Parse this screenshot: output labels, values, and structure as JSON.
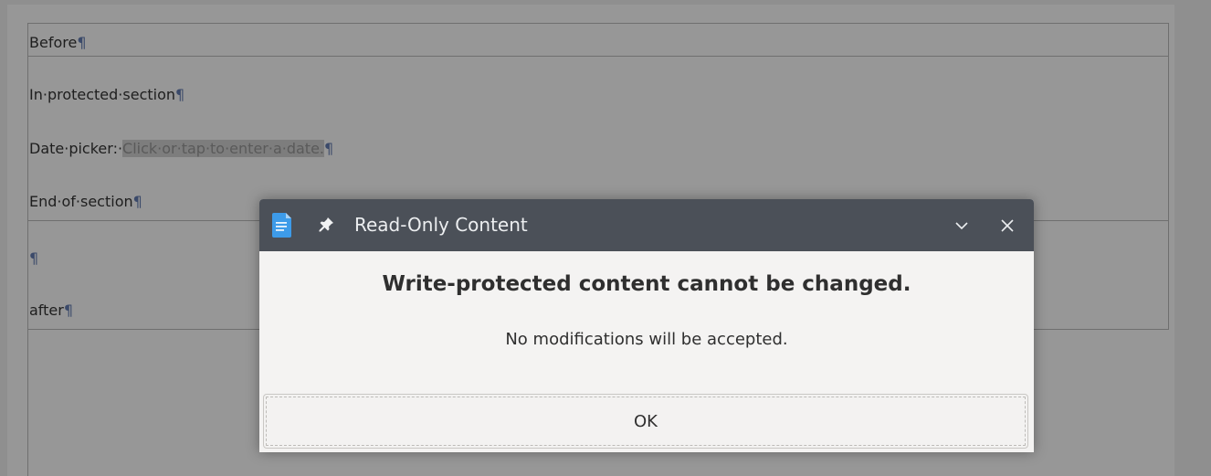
{
  "document": {
    "lines": [
      {
        "text": "Before",
        "mark": "¶"
      },
      {
        "text": "In·protected·section",
        "mark": "¶"
      },
      {
        "label": "Date·picker:·",
        "placeholder": "Click·or·tap·to·enter·a·date.",
        "mark": "¶"
      },
      {
        "text": "End·of·section",
        "mark": "¶"
      },
      {
        "text": "",
        "mark": "¶"
      },
      {
        "text": "after",
        "mark": "¶"
      }
    ]
  },
  "dialog": {
    "title": "Read-Only Content",
    "heading": "Write-protected content cannot be changed.",
    "message": "No modifications will be accepted.",
    "ok_label": "OK",
    "icons": {
      "app": "writer-document-icon",
      "pin": "pin-icon",
      "collapse": "chevron-down-icon",
      "close": "close-icon"
    }
  },
  "colors": {
    "titlebar": "#4b5058",
    "dialog_bg": "#f4f3f2",
    "page_bg": "#979797",
    "accent": "#3d9be9"
  }
}
